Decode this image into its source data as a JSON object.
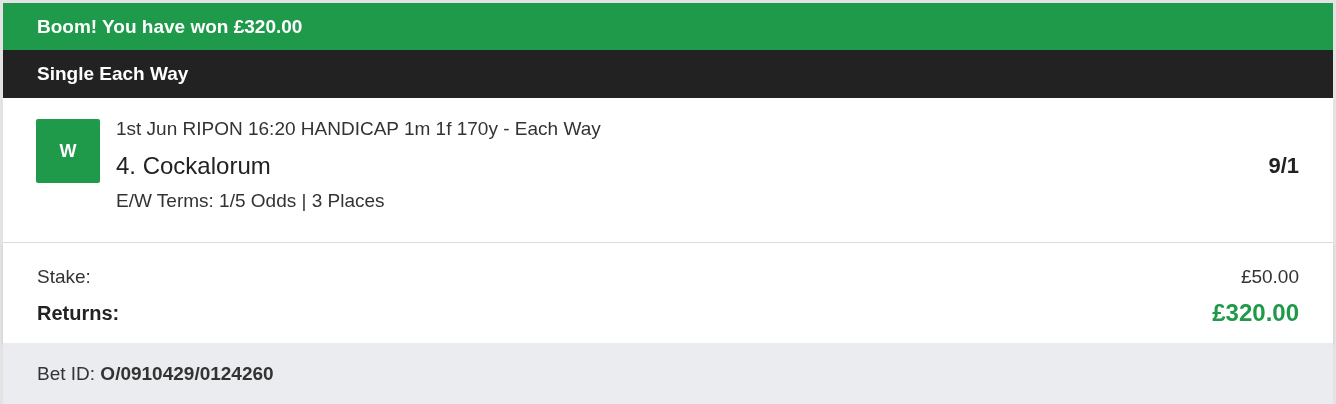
{
  "banner": {
    "message": "Boom! You have won £320.00"
  },
  "bet_type": "Single Each Way",
  "selection": {
    "result": "W",
    "event": "1st Jun RIPON 16:20 HANDICAP 1m 1f 170y - Each Way",
    "runner": "4. Cockalorum",
    "odds": "9/1",
    "terms": "E/W Terms: 1/5 Odds | 3 Places"
  },
  "totals": [
    {
      "label": "Stake:",
      "value": "£50.00",
      "kind": "stake"
    },
    {
      "label": "Returns:",
      "value": "£320.00",
      "kind": "returns"
    }
  ],
  "footer": {
    "bet_id": "Bet ID: **O/0910429/0124260**"
  }
}
